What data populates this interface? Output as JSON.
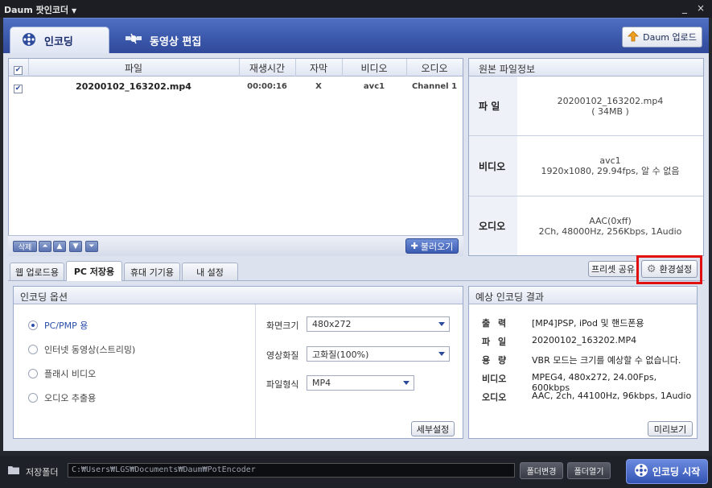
{
  "window": {
    "title": "Daum 팟인코더",
    "title_arrow": "▼",
    "minimize": "_",
    "close": "×"
  },
  "header": {
    "tabs": [
      {
        "label": "인코딩"
      },
      {
        "label": "동영상 편집"
      }
    ],
    "upload_label": "Daum 업로드"
  },
  "file_list": {
    "columns": [
      "파일",
      "재생시간",
      "자막",
      "비디오",
      "오디오"
    ],
    "rows": [
      {
        "file": "20200102_163202.mp4",
        "duration": "00:00:16",
        "subtitle": "X",
        "video": "avc1",
        "audio": "Channel 1",
        "checked": true
      }
    ],
    "footer": {
      "delete_label": "삭제",
      "load_label": "불러오기"
    }
  },
  "source_info": {
    "title": "원본 파일정보",
    "rows": [
      {
        "label": "파  일",
        "line1": "20200102_163202.mp4",
        "line2": "( 34MB )"
      },
      {
        "label": "비디오",
        "line1": "avc1",
        "line2": "1920x1080, 29.94fps, 알 수 없음"
      },
      {
        "label": "오디오",
        "line1": "AAC(0xff)",
        "line2": "2Ch, 48000Hz, 256Kbps, 1Audio"
      }
    ]
  },
  "sub_tabs": [
    "웹 업로드용",
    "PC 저장용",
    "휴대 기기용",
    "내 설정"
  ],
  "preset_share_label": "프리셋 공유",
  "env_settings_label": "환경설정",
  "highlight_color": "#e01010",
  "encode_options": {
    "title": "인코딩 옵션",
    "radios": [
      {
        "label": "PC/PMP 용",
        "selected": true
      },
      {
        "label": "인터넷 동영상(스트리밍)",
        "selected": false
      },
      {
        "label": "플래시 비디오",
        "selected": false
      },
      {
        "label": "오디오 추출용",
        "selected": false
      }
    ],
    "fields": [
      {
        "label": "화면크기",
        "value": "480x272"
      },
      {
        "label": "영상화질",
        "value": "고화질(100%)"
      },
      {
        "label": "파일형식",
        "value": "MP4"
      }
    ],
    "detail_label": "세부설정"
  },
  "expected_result": {
    "title": "예상 인코딩 결과",
    "rows": [
      {
        "label": "출  력",
        "value": "[MP4]PSP, iPod 및 핸드폰용"
      },
      {
        "label": "파  일",
        "value": "20200102_163202.MP4"
      },
      {
        "label": "용  량",
        "value": "VBR 모드는 크기를 예상할 수 없습니다."
      },
      {
        "label": "비디오",
        "value": "MPEG4, 480x272, 24.00Fps, 600kbps"
      },
      {
        "label": "오디오",
        "value": "AAC, 2ch, 44100Hz, 96kbps, 1Audio"
      }
    ],
    "preview_label": "미리보기"
  },
  "bottom": {
    "folder_label": "저장폴더",
    "path": "C:₩Users₩LGS₩Documents₩Daum₩PotEncoder",
    "change_folder": "폴더변경",
    "open_folder": "폴더열기",
    "start_label": "인코딩 시작"
  }
}
